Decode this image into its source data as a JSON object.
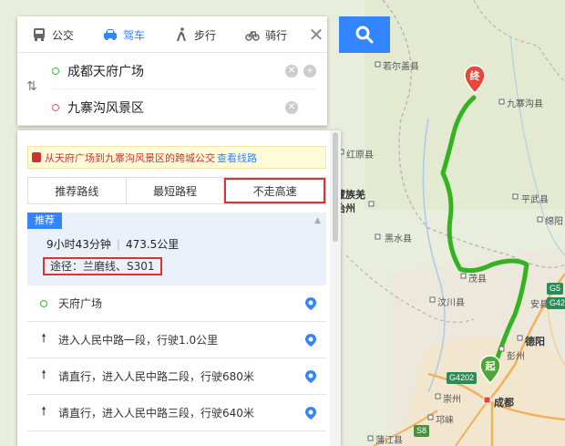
{
  "mode_tabs": [
    {
      "label": "公交",
      "icon": "bus-icon"
    },
    {
      "label": "驾车",
      "icon": "car-icon",
      "active": true
    },
    {
      "label": "步行",
      "icon": "walk-icon"
    },
    {
      "label": "骑行",
      "icon": "bike-icon"
    }
  ],
  "start": "成都天府广场",
  "end": "九寨沟风景区",
  "bus_tip": {
    "text": "从天府广场到九寨沟风景区的跨城公交",
    "link": "查看线路"
  },
  "route_tabs": [
    "推荐路线",
    "最短路程",
    "不走高速"
  ],
  "selected_route_tab": 2,
  "route": {
    "badge": "推荐",
    "time": "9小时43分钟",
    "distance": "473.5公里",
    "via": "途径：兰磨线、S301"
  },
  "steps": [
    {
      "text": "天府广场",
      "type": "start"
    },
    {
      "text": "进入人民中路一段，行驶1.0公里",
      "type": "straight"
    },
    {
      "text": "请直行，进入人民中路二段，行驶680米",
      "type": "straight"
    },
    {
      "text": "请直行，进入人民中路三段，行驶640米",
      "type": "straight"
    }
  ],
  "map": {
    "labels": [
      "若尔盖县",
      "九寨沟县",
      "红原县",
      "藏族羌",
      "治州",
      "黑水县",
      "平武县",
      "绵阳",
      "茂县",
      "汶川县",
      "彭州",
      "德阳",
      "崇州",
      "成都",
      "邛崃",
      "蒲江县",
      "安县"
    ],
    "shields": [
      "G5",
      "G42",
      "G4202",
      "S8"
    ],
    "markers": {
      "end": "终",
      "start": "起"
    },
    "colors": {
      "route": "#33b320",
      "start_marker": "#4fa63a",
      "end_marker": "#e8473a",
      "accent": "#3385ff"
    }
  }
}
